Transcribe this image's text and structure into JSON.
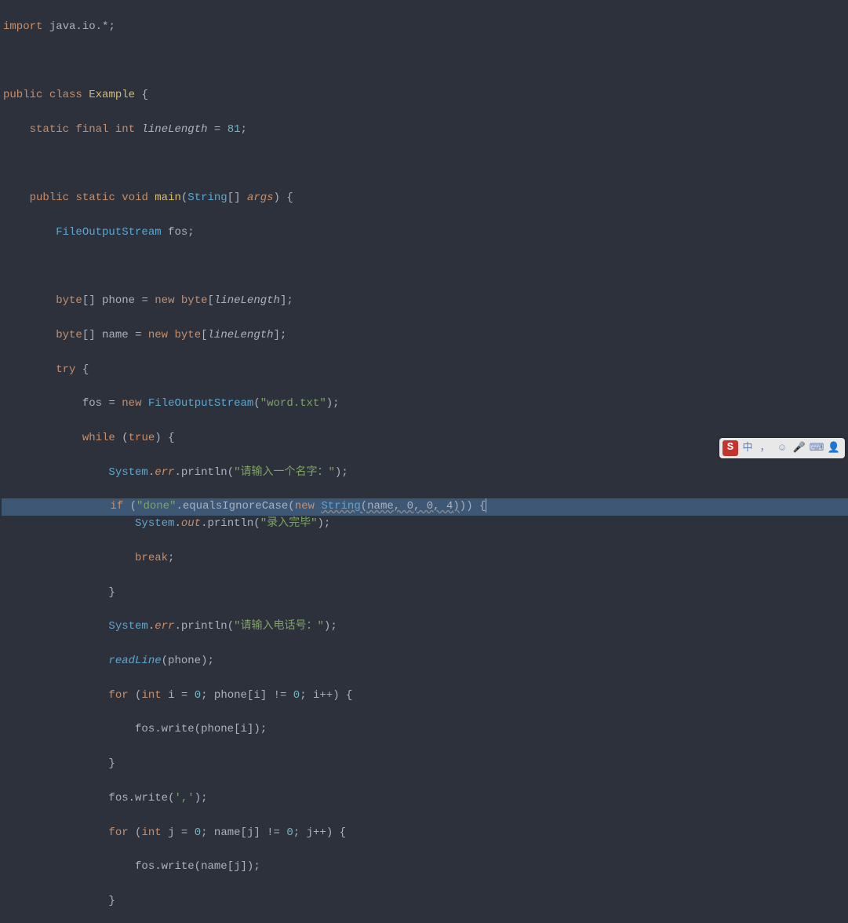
{
  "code": {
    "l1": {
      "kw": "import",
      "pkg": "java.io.*",
      "semi": ";"
    },
    "l2": {
      "kw1": "public",
      "kw2": "class",
      "name": "Example",
      "brace": "{"
    },
    "l3": {
      "kw1": "static",
      "kw2": "final",
      "kw3": "int",
      "var": "lineLength",
      "eq": "=",
      "num": "81",
      "semi": ";"
    },
    "l4": {
      "kw1": "public",
      "kw2": "static",
      "kw3": "void",
      "fn": "main",
      "lp": "(",
      "type": "String",
      "arr": "[]",
      "arg": "args",
      "rp": ")",
      "brace": "{"
    },
    "l5": {
      "type": "FileOutputStream",
      "var": "fos",
      "semi": ";"
    },
    "l6": {
      "kw": "byte",
      "arr": "[]",
      "var": "phone",
      "eq": "=",
      "kwnew": "new",
      "kwbyte": "byte",
      "lb": "[",
      "len": "lineLength",
      "rb": "]",
      "semi": ";"
    },
    "l7": {
      "kw": "byte",
      "arr": "[]",
      "var": "name",
      "eq": "=",
      "kwnew": "new",
      "kwbyte": "byte",
      "lb": "[",
      "len": "lineLength",
      "rb": "]",
      "semi": ";"
    },
    "l8": {
      "kw": "try",
      "brace": "{"
    },
    "l9": {
      "var": "fos",
      "eq": "=",
      "kwnew": "new",
      "type": "FileOutputStream",
      "lp": "(",
      "str": "\"word.txt\"",
      "rp": ")",
      "semi": ";"
    },
    "l10": {
      "kw": "while",
      "lp": "(",
      "cond": "true",
      "rp": ")",
      "brace": "{"
    },
    "l11": {
      "cls": "System",
      "dot1": ".",
      "field": "err",
      "dot2": ".",
      "fn": "println",
      "lp": "(",
      "str": "\"请输入一个名字：\"",
      "rp": ")",
      "semi": ";"
    },
    "l12": {
      "kwif": "if",
      "lp": "(",
      "str": "\"done\"",
      "dot": ".",
      "fn": "equalsIgnoreCase",
      "lp2": "(",
      "kwnew": "new",
      "type": "String",
      "lp3": "(",
      "args": "name, 0, 0, 4",
      "rp3": ")",
      "rp2": ")",
      "rp": ")",
      "brace": "{"
    },
    "l13": {
      "cls": "System",
      "dot1": ".",
      "field": "out",
      "dot2": ".",
      "fn": "println",
      "lp": "(",
      "str": "\"录入完毕\"",
      "rp": ")",
      "semi": ";"
    },
    "l14": {
      "kw": "break",
      "semi": ";"
    },
    "l15": {
      "brace": "}"
    },
    "l16": {
      "cls": "System",
      "dot1": ".",
      "field": "err",
      "dot2": ".",
      "fn": "println",
      "lp": "(",
      "str": "\"请输入电话号：\"",
      "rp": ")",
      "semi": ";"
    },
    "l17": {
      "fn": "readLine",
      "lp": "(",
      "arg": "phone",
      "rp": ")",
      "semi": ";"
    },
    "l18": {
      "kwfor": "for",
      "lp": "(",
      "kwint": "int",
      "var": "i",
      "eq": "=",
      "num": "0",
      "semi1": ";",
      "arr": "phone",
      "lb": "[",
      "idx": "i",
      "rb": "]",
      "ne": "!=",
      "zero": "0",
      "semi2": ";",
      "inc": "i++",
      "rp": ")",
      "brace": "{"
    },
    "l19": {
      "obj": "fos",
      "dot": ".",
      "fn": "write",
      "lp": "(",
      "arr": "phone",
      "lb": "[",
      "idx": "i",
      "rb": "]",
      "rp": ")",
      "semi": ";"
    },
    "l20": {
      "brace": "}"
    },
    "l21": {
      "obj": "fos",
      "dot": ".",
      "fn": "write",
      "lp": "(",
      "ch": "','",
      "rp": ")",
      "semi": ";"
    },
    "l22": {
      "kwfor": "for",
      "lp": "(",
      "kwint": "int",
      "var": "j",
      "eq": "=",
      "num": "0",
      "semi1": ";",
      "arr": "name",
      "lb": "[",
      "idx": "j",
      "rb": "]",
      "ne": "!=",
      "zero": "0",
      "semi2": ";",
      "inc": "j++",
      "rp": ")",
      "brace": "{"
    },
    "l23": {
      "obj": "fos",
      "dot": ".",
      "fn": "write",
      "lp": "(",
      "arr": "name",
      "lb": "[",
      "idx": "j",
      "rb": "]",
      "rp": ")",
      "semi": ";"
    },
    "l24": {
      "brace": "}"
    }
  },
  "toolbar": {
    "logo": "S",
    "lang": "中",
    "punc": "，",
    "items": [
      "☺",
      "🎤",
      "⌨",
      "👤"
    ]
  }
}
